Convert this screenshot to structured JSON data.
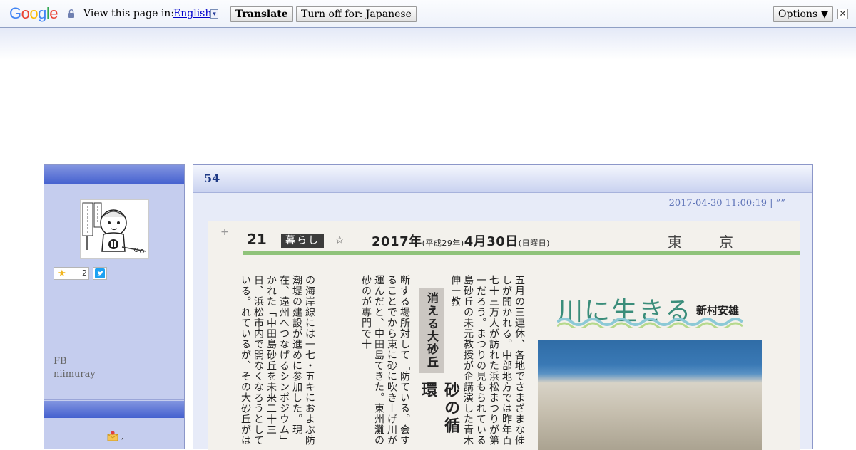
{
  "translate_bar": {
    "logo": "Google",
    "view_text": "View this page in:",
    "language": "English",
    "translate_label": "Translate",
    "turn_off_label": "Turn off for: Japanese",
    "options_label": "Options ▼",
    "close_glyph": "✕",
    "dropdown_glyph": "▾"
  },
  "sidebar": {
    "star_count": "2",
    "fb_label": "FB",
    "fb_user": "niimuray",
    "mail_suffix": ","
  },
  "entry": {
    "title": "54",
    "datetime": "2017-04-30 11:00:19 | ””"
  },
  "newspaper": {
    "page_number": "21",
    "section": "暮らし",
    "star": "☆",
    "date_year": "2017年",
    "date_era": "(平成29年)",
    "date_md": "4月30日",
    "date_dow": "(日曜日)",
    "masthead": "東京",
    "plus": "+",
    "column1": "の海岸線には一七・五キにおよぶ防潮堤の建設が進めに参加した。現在、遠州へつなげるシンポジウム」かれた「中田島砂丘を未来二十三日、浜松市内で開なくなろうとしている。れているが、その大砂丘がは日本三大砂丘として知ら会場に隣接する中田島砂丘のは「凧揚げ合戦」。その",
    "headline_box": "消える大砂丘",
    "headline_big": "砂の循環",
    "column2": "断する場所対して「防ている。会することでから東に砂に吹き上げ川が運んだと、中田島てきた。東州灘の砂のが専門で十",
    "column3": "五月の三連休、各地でさまざまな催しが開かれる。中部地方では昨年百七十三万人が訪れた浜松まつりが第一だろう。まつりの見もられている島砂丘の未元教授が企講演した青木伸一教",
    "serial_title": "川に生きる",
    "serial_author": "新村安雄"
  },
  "colors": {
    "sidebar_header": "#4460cf",
    "sidebar_bg": "#c5cdee",
    "entry_bg": "#e7ebf8",
    "link_blue": "#0000cc"
  }
}
